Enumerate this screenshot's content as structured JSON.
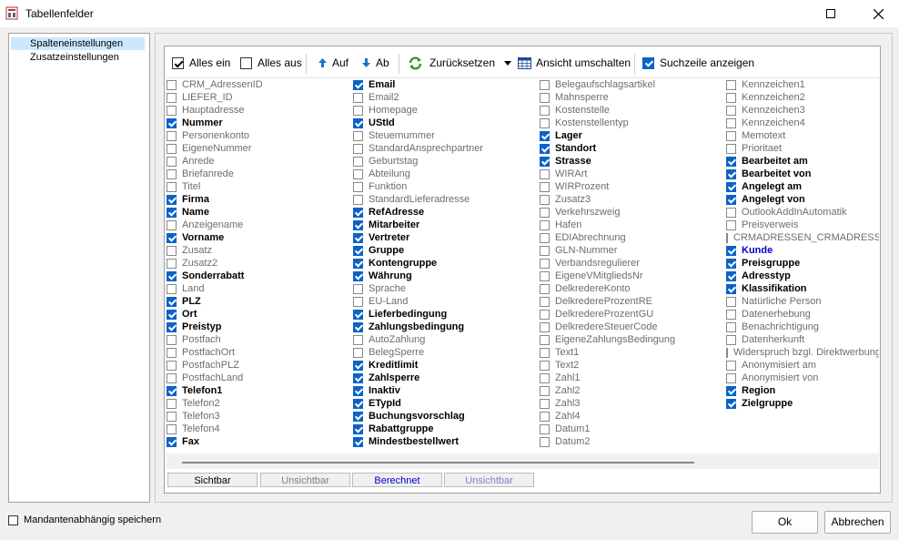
{
  "window": {
    "title": "Tabellenfelder"
  },
  "nav": [
    {
      "label": "Spalteneinstellungen",
      "selected": true
    },
    {
      "label": "Zusatzeinstellungen",
      "selected": false
    }
  ],
  "toolbar": {
    "all_on": "Alles ein",
    "all_off": "Alles aus",
    "up": "Auf",
    "down": "Ab",
    "reset": "Zurücksetzen",
    "switch_view": "Ansicht umschalten",
    "show_search": "Suchzeile anzeigen"
  },
  "columns": [
    [
      {
        "label": "CRM_AdressenID",
        "on": false
      },
      {
        "label": "LIEFER_ID",
        "on": false
      },
      {
        "label": "Hauptadresse",
        "on": false
      },
      {
        "label": "Nummer",
        "on": true
      },
      {
        "label": "Personenkonto",
        "on": false
      },
      {
        "label": "EigeneNummer",
        "on": false
      },
      {
        "label": "Anrede",
        "on": false
      },
      {
        "label": "Briefanrede",
        "on": false
      },
      {
        "label": "Titel",
        "on": false
      },
      {
        "label": "Firma",
        "on": true
      },
      {
        "label": "Name",
        "on": true
      },
      {
        "label": "Anzeigename",
        "on": false
      },
      {
        "label": "Vorname",
        "on": true
      },
      {
        "label": "Zusatz",
        "on": false
      },
      {
        "label": "Zusatz2",
        "on": false
      },
      {
        "label": "Sonderrabatt",
        "on": true
      },
      {
        "label": "Land",
        "on": false
      },
      {
        "label": "PLZ",
        "on": true
      },
      {
        "label": "Ort",
        "on": true
      },
      {
        "label": "Preistyp",
        "on": true
      },
      {
        "label": "Postfach",
        "on": false
      },
      {
        "label": "PostfachOrt",
        "on": false
      },
      {
        "label": "PostfachPLZ",
        "on": false
      },
      {
        "label": "PostfachLand",
        "on": false
      },
      {
        "label": "Telefon1",
        "on": true
      },
      {
        "label": "Telefon2",
        "on": false
      },
      {
        "label": "Telefon3",
        "on": false
      },
      {
        "label": "Telefon4",
        "on": false
      },
      {
        "label": "Fax",
        "on": true
      }
    ],
    [
      {
        "label": "Email",
        "on": true
      },
      {
        "label": "Email2",
        "on": false
      },
      {
        "label": "Homepage",
        "on": false
      },
      {
        "label": "UStId",
        "on": true
      },
      {
        "label": "Steuernummer",
        "on": false
      },
      {
        "label": "StandardAnsprechpartner",
        "on": false
      },
      {
        "label": "Geburtstag",
        "on": false
      },
      {
        "label": "Abteilung",
        "on": false
      },
      {
        "label": "Funktion",
        "on": false
      },
      {
        "label": "StandardLieferadresse",
        "on": false
      },
      {
        "label": "RefAdresse",
        "on": true
      },
      {
        "label": "Mitarbeiter",
        "on": true
      },
      {
        "label": "Vertreter",
        "on": true
      },
      {
        "label": "Gruppe",
        "on": true
      },
      {
        "label": "Kontengruppe",
        "on": true
      },
      {
        "label": "Währung",
        "on": true
      },
      {
        "label": "Sprache",
        "on": false
      },
      {
        "label": "EU-Land",
        "on": false
      },
      {
        "label": "Lieferbedingung",
        "on": true
      },
      {
        "label": "Zahlungsbedingung",
        "on": true
      },
      {
        "label": "AutoZahlung",
        "on": false
      },
      {
        "label": "BelegSperre",
        "on": false
      },
      {
        "label": "Kreditlimit",
        "on": true
      },
      {
        "label": "Zahlsperre",
        "on": true
      },
      {
        "label": "Inaktiv",
        "on": true
      },
      {
        "label": "ETypId",
        "on": true
      },
      {
        "label": "Buchungsvorschlag",
        "on": true
      },
      {
        "label": "Rabattgruppe",
        "on": true
      },
      {
        "label": "Mindestbestellwert",
        "on": true
      }
    ],
    [
      {
        "label": "Belegaufschlagsartikel",
        "on": false
      },
      {
        "label": "Mahnsperre",
        "on": false
      },
      {
        "label": "Kostenstelle",
        "on": false
      },
      {
        "label": "Kostenstellentyp",
        "on": false
      },
      {
        "label": "Lager",
        "on": true
      },
      {
        "label": "Standort",
        "on": true
      },
      {
        "label": "Strasse",
        "on": true
      },
      {
        "label": "WIRArt",
        "on": false
      },
      {
        "label": "WIRProzent",
        "on": false
      },
      {
        "label": "Zusatz3",
        "on": false
      },
      {
        "label": "Verkehrszweig",
        "on": false
      },
      {
        "label": "Hafen",
        "on": false
      },
      {
        "label": "EDIAbrechnung",
        "on": false
      },
      {
        "label": "GLN-Nummer",
        "on": false
      },
      {
        "label": "Verbandsregulierer",
        "on": false
      },
      {
        "label": "EigeneVMitgliedsNr",
        "on": false
      },
      {
        "label": "DelkredereKonto",
        "on": false
      },
      {
        "label": "DelkredereProzentRE",
        "on": false
      },
      {
        "label": "DelkredereProzentGU",
        "on": false
      },
      {
        "label": "DelkredereSteuerCode",
        "on": false
      },
      {
        "label": "EigeneZahlungsBedingung",
        "on": false
      },
      {
        "label": "Text1",
        "on": false
      },
      {
        "label": "Text2",
        "on": false
      },
      {
        "label": "Zahl1",
        "on": false
      },
      {
        "label": "Zahl2",
        "on": false
      },
      {
        "label": "Zahl3",
        "on": false
      },
      {
        "label": "Zahl4",
        "on": false
      },
      {
        "label": "Datum1",
        "on": false
      },
      {
        "label": "Datum2",
        "on": false
      }
    ],
    [
      {
        "label": "Kennzeichen1",
        "on": false
      },
      {
        "label": "Kennzeichen2",
        "on": false
      },
      {
        "label": "Kennzeichen3",
        "on": false
      },
      {
        "label": "Kennzeichen4",
        "on": false
      },
      {
        "label": "Memotext",
        "on": false
      },
      {
        "label": "Prioritaet",
        "on": false
      },
      {
        "label": "Bearbeitet am",
        "on": true
      },
      {
        "label": "Bearbeitet von",
        "on": true
      },
      {
        "label": "Angelegt am",
        "on": true
      },
      {
        "label": "Angelegt von",
        "on": true
      },
      {
        "label": "OutlookAddInAutomatik",
        "on": false
      },
      {
        "label": "Preisverweis",
        "on": false
      },
      {
        "label": "CRMADRESSEN_CRMADRESSE",
        "on": false
      },
      {
        "label": "Kunde",
        "on": true,
        "blue": true
      },
      {
        "label": "Preisgruppe",
        "on": true
      },
      {
        "label": "Adresstyp",
        "on": true
      },
      {
        "label": "Klassifikation",
        "on": true
      },
      {
        "label": "Natürliche Person",
        "on": false
      },
      {
        "label": "Datenerhebung",
        "on": false
      },
      {
        "label": "Benachrichtigung",
        "on": false
      },
      {
        "label": "Datenherkunft",
        "on": false
      },
      {
        "label": "Widerspruch bzgl. Direktwerbung",
        "on": false
      },
      {
        "label": "Anonymisiert am",
        "on": false
      },
      {
        "label": "Anonymisiert von",
        "on": false
      },
      {
        "label": "Region",
        "on": true
      },
      {
        "label": "Zielgruppe",
        "on": true
      }
    ]
  ],
  "legend": [
    {
      "label": "Sichtbar",
      "color": "#000000",
      "bold": false
    },
    {
      "label": "Unsichtbar",
      "color": "#808080",
      "bold": false
    },
    {
      "label": "Berechnet",
      "color": "#0000cc",
      "bold": false
    },
    {
      "label": "Unsichtbar",
      "color": "#8080d0",
      "bold": false
    }
  ],
  "footer": {
    "tenant_save": "Mandantenabhängig speichern",
    "ok": "Ok",
    "cancel": "Abbrechen"
  }
}
